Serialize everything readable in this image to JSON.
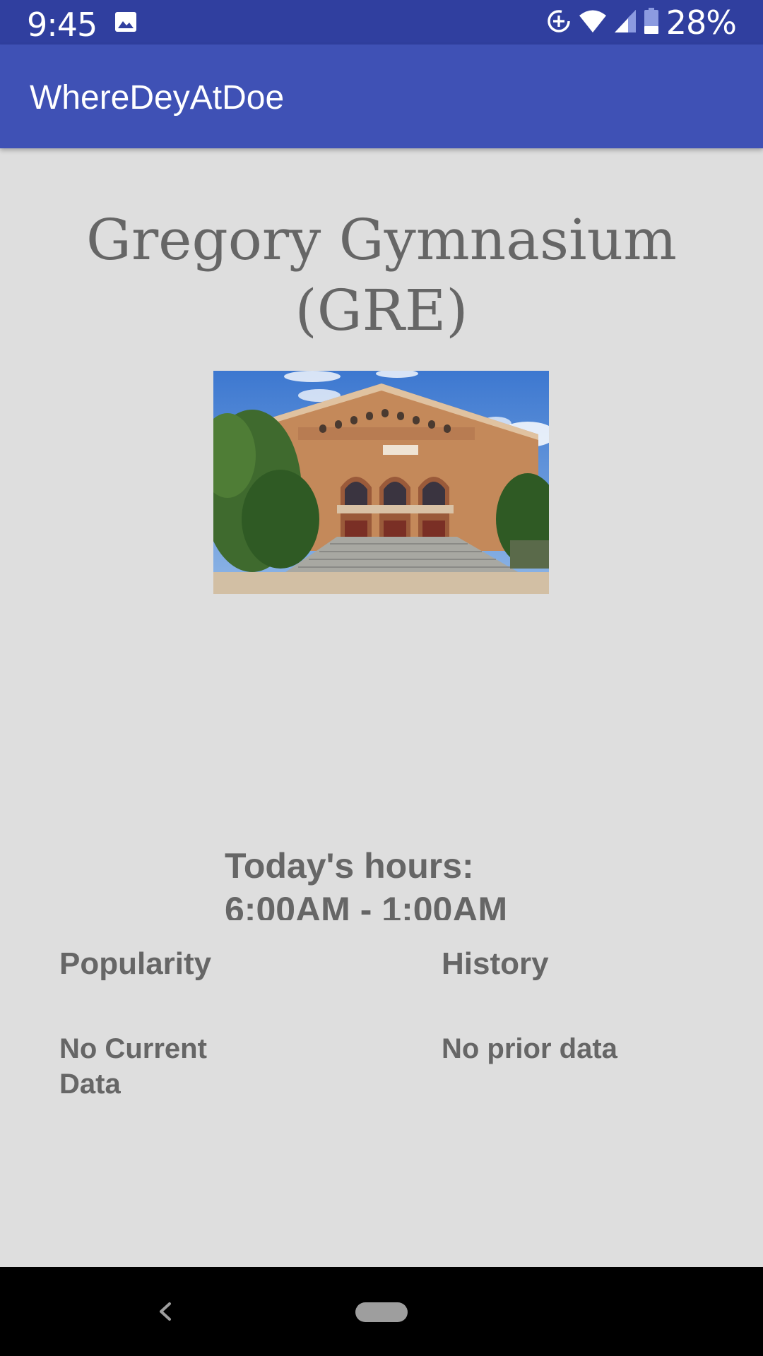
{
  "status_bar": {
    "time": "9:45",
    "battery_percent": "28%",
    "icons": [
      "image-icon",
      "data-saver-icon",
      "wifi-icon",
      "cell-signal-icon",
      "battery-icon"
    ]
  },
  "app_bar": {
    "title": "WhereDeyAtDoe"
  },
  "place": {
    "name_line1": "Gregory Gymnasium",
    "name_line2": "(GRE)"
  },
  "hours": {
    "label": "Today's hours:",
    "value": "6:00AM - 1:00AM"
  },
  "popularity": {
    "label": "Popularity",
    "value_line1": "No Current",
    "value_line2": "Data"
  },
  "history": {
    "label": "History",
    "value": "No prior data"
  },
  "colors": {
    "status_bar": "#303f9f",
    "app_bar": "#3f51b5",
    "background": "#dedede",
    "text": "#666666"
  }
}
